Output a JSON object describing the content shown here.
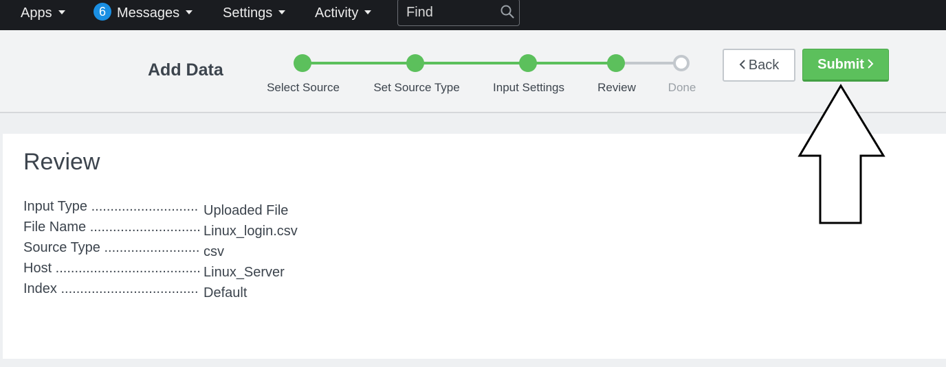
{
  "topnav": {
    "apps_label": "Apps",
    "messages_count": "6",
    "messages_label": "Messages",
    "settings_label": "Settings",
    "activity_label": "Activity",
    "search_placeholder": "Find"
  },
  "header": {
    "title": "Add Data",
    "steps": [
      {
        "label": "Select Source",
        "status": "complete"
      },
      {
        "label": "Set Source Type",
        "status": "complete"
      },
      {
        "label": "Input Settings",
        "status": "complete"
      },
      {
        "label": "Review",
        "status": "current"
      },
      {
        "label": "Done",
        "status": "pending"
      }
    ],
    "back_label": "Back",
    "submit_label": "Submit"
  },
  "review": {
    "title": "Review",
    "rows": [
      {
        "key": "Input Type",
        "value": "Uploaded File"
      },
      {
        "key": "File Name",
        "value": "Linux_login.csv"
      },
      {
        "key": "Source Type",
        "value": "csv"
      },
      {
        "key": "Host",
        "value": "Linux_Server"
      },
      {
        "key": "Index",
        "value": "Default"
      }
    ]
  },
  "colors": {
    "accent_green": "#5cc05c",
    "nav_bg": "#1a1c20",
    "badge_blue": "#1a8fe3"
  },
  "icons": {
    "search": "search-icon",
    "caret": "caret-down-icon",
    "back_chevron": "chevron-left-icon",
    "submit_chevron": "chevron-right-icon",
    "annotation": "up-arrow-icon"
  }
}
